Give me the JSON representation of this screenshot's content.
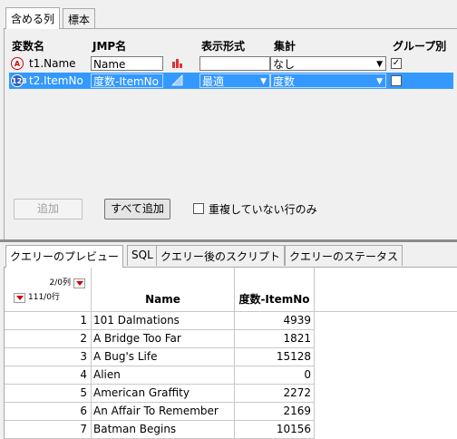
{
  "top_tabs": [
    "含める列",
    "標本"
  ],
  "columns_table": {
    "headers": {
      "var_name": "変数名",
      "jmp_name": "JMP名",
      "format": "表示形式",
      "summary": "集計",
      "group_by": "グループ別"
    },
    "rows": [
      {
        "var_name": "t1.Name",
        "jmp_name": "Name",
        "type_icon": "character-A-icon",
        "modeling_icon": "nominal-bars-icon",
        "format": "",
        "summary": "なし",
        "group_by_checked": true,
        "selected": false
      },
      {
        "var_name": "t2.ItemNo",
        "jmp_name": "度数-ItemNo",
        "type_icon": "numeric-123-icon",
        "modeling_icon": "continuous-triangle-icon",
        "format": "最適",
        "summary": "度数",
        "group_by_checked": false,
        "selected": true
      }
    ]
  },
  "buttons": {
    "add": "追加",
    "add_all": "すべて追加"
  },
  "unique_rows": {
    "label": "重複していない行のみ",
    "checked": false
  },
  "bottom_tabs": [
    "クエリーのプレビュー",
    "SQL",
    "クエリー後のスクリプト",
    "クエリーのステータス"
  ],
  "preview": {
    "cols_count": "2/0列",
    "rows_count": "111/0行",
    "headers": [
      "Name",
      "度数-ItemNo"
    ],
    "rows": [
      {
        "n": "1",
        "name": "101 Dalmations",
        "count": "4939"
      },
      {
        "n": "2",
        "name": "A Bridge Too Far",
        "count": "1821"
      },
      {
        "n": "3",
        "name": "A Bug's Life",
        "count": "15128"
      },
      {
        "n": "4",
        "name": "Alien",
        "count": "0"
      },
      {
        "n": "5",
        "name": "American Graffity",
        "count": "2272"
      },
      {
        "n": "6",
        "name": "An Affair To Remember",
        "count": "2169"
      },
      {
        "n": "7",
        "name": "Batman Begins",
        "count": "10156"
      }
    ]
  },
  "colors": {
    "selection": "#3399ff",
    "accent_red": "#cc0000"
  }
}
